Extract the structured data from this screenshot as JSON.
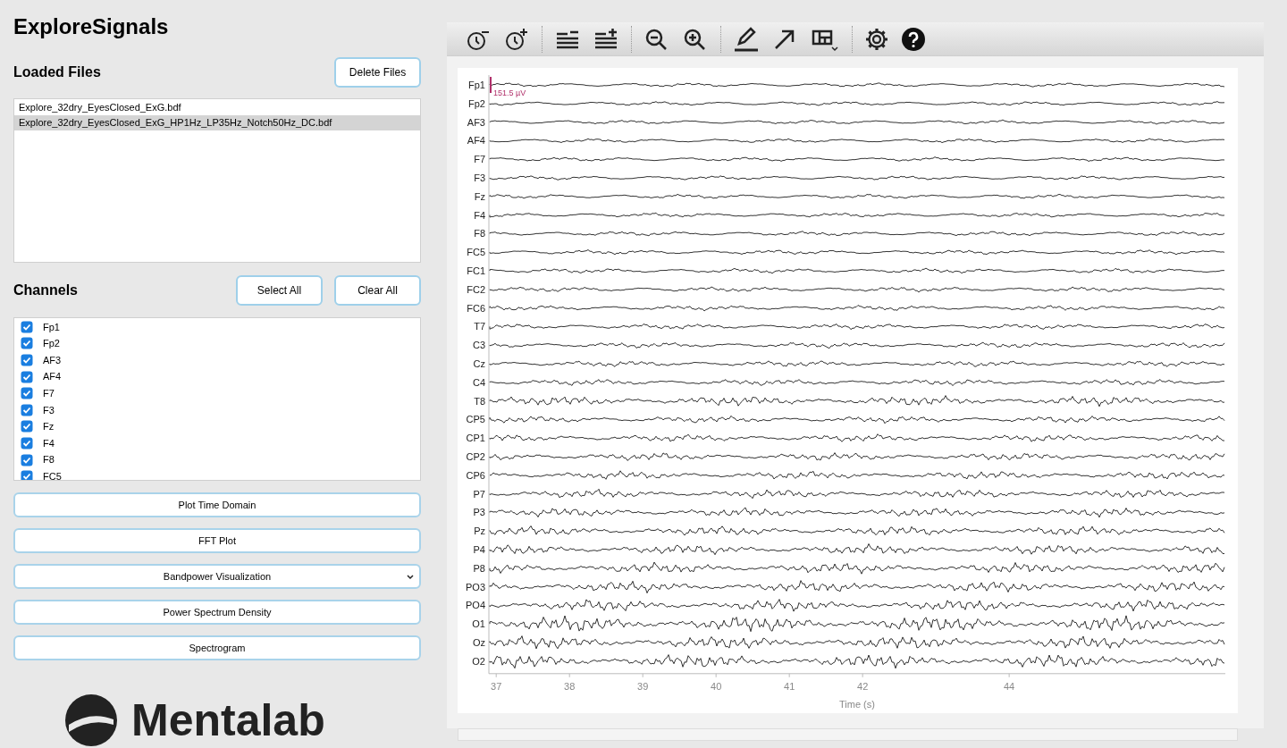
{
  "app": {
    "title": "ExploreSignals",
    "brand": "Mentalab"
  },
  "loaded_files": {
    "heading": "Loaded Files",
    "delete_button": "Delete Files",
    "files": [
      {
        "name": "Explore_32dry_EyesClosed_ExG.bdf",
        "selected": false
      },
      {
        "name": "Explore_32dry_EyesClosed_ExG_HP1Hz_LP35Hz_Notch50Hz_DC.bdf",
        "selected": true
      }
    ]
  },
  "channels": {
    "heading": "Channels",
    "select_all": "Select All",
    "clear_all": "Clear All",
    "items": [
      {
        "label": "Fp1",
        "checked": true
      },
      {
        "label": "Fp2",
        "checked": true
      },
      {
        "label": "AF3",
        "checked": true
      },
      {
        "label": "AF4",
        "checked": true
      },
      {
        "label": "F7",
        "checked": true
      },
      {
        "label": "F3",
        "checked": true
      },
      {
        "label": "Fz",
        "checked": true
      },
      {
        "label": "F4",
        "checked": true
      },
      {
        "label": "F8",
        "checked": true
      },
      {
        "label": "FC5",
        "checked": true
      }
    ]
  },
  "actions": [
    {
      "label": "Plot Time Domain",
      "kind": "button"
    },
    {
      "label": "FFT Plot",
      "kind": "button"
    },
    {
      "label": "Bandpower Visualization",
      "kind": "dropdown"
    },
    {
      "label": "Power Spectrum Density",
      "kind": "button"
    },
    {
      "label": "Spectrogram",
      "kind": "button"
    }
  ],
  "plot": {
    "scale_label": "151.5 µV",
    "xlabel": "Time (s)",
    "channels": [
      "Fp1",
      "Fp2",
      "AF3",
      "AF4",
      "F7",
      "F3",
      "Fz",
      "F4",
      "F8",
      "FC5",
      "FC1",
      "FC2",
      "FC6",
      "T7",
      "C3",
      "Cz",
      "C4",
      "T8",
      "CP5",
      "CP1",
      "CP2",
      "CP6",
      "P7",
      "P3",
      "Pz",
      "P4",
      "P8",
      "PO3",
      "PO4",
      "O1",
      "Oz",
      "O2"
    ],
    "x_ticks": [
      "37",
      "38",
      "39",
      "40",
      "41",
      "42",
      "44"
    ]
  }
}
